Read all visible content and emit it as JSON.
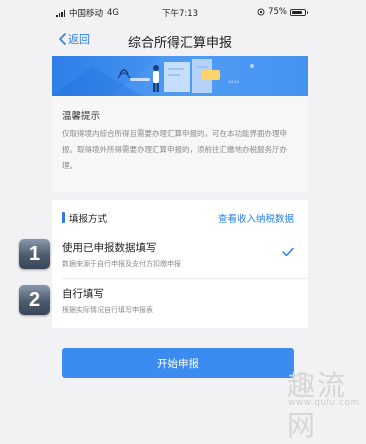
{
  "status_bar": {
    "carrier": "中国移动",
    "network": "4G",
    "time": "下午7:13",
    "battery_percent": "75%"
  },
  "nav": {
    "back_label": "返回",
    "title": "综合所得汇算申报"
  },
  "tips": {
    "title": "温馨提示",
    "text": "仅取得境内综合所得且需要办理汇算申报的，可在本功能界面办理申报。取得境外所得需要办理汇算申报的，须前往汇缴地办税服务厅办理。"
  },
  "method": {
    "label": "填报方式",
    "link": "查看收入纳税数据"
  },
  "options": [
    {
      "number": "1",
      "title": "使用已申报数据填写",
      "subtitle": "数据来源于自行申报及支付方扣缴申报",
      "selected": true
    },
    {
      "number": "2",
      "title": "自行填写",
      "subtitle": "根据实际情况自行填写申报表",
      "selected": false
    }
  ],
  "start_button": "开始申报",
  "watermark": "趣流网",
  "watermark_url": "www.qulu.com",
  "colors": {
    "primary": "#2a7fec",
    "button": "#3b8bf0",
    "background": "#f2f2f4"
  }
}
